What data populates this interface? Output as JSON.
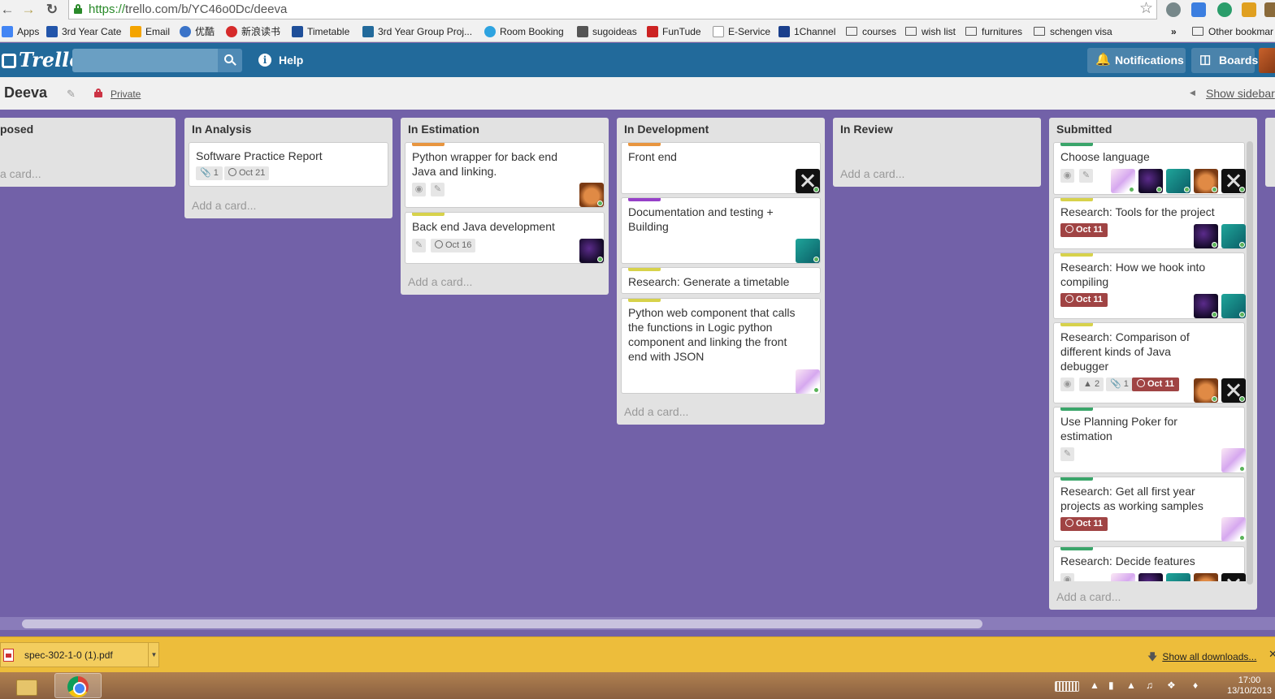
{
  "browser": {
    "url_scheme": "https://",
    "url_rest": "trello.com/b/YC46o0Dc/deeva",
    "bookmarks": [
      {
        "label": "Apps",
        "color": "#4285f4"
      },
      {
        "label": "3rd Year Cate",
        "color": "#2255aa"
      },
      {
        "label": "Email",
        "color": "#f4a400"
      },
      {
        "label": "优酷",
        "color": "#3a73c8"
      },
      {
        "label": "新浪读书",
        "color": "#d62b2b"
      },
      {
        "label": "Timetable",
        "color": "#1f4f99"
      },
      {
        "label": "3rd Year Group Proj...",
        "color": "#226a9b"
      },
      {
        "label": "Room Booking",
        "color": "#2ea3e0"
      },
      {
        "label": "sugoideas",
        "color": "#555555"
      },
      {
        "label": "FunTude",
        "color": "#cc2222"
      },
      {
        "label": "E-Service",
        "color": "#ffffff"
      },
      {
        "label": "1Channel",
        "color": "#1a3f8c"
      },
      {
        "label": "courses",
        "folder": true
      },
      {
        "label": "wish list",
        "folder": true
      },
      {
        "label": "furnitures",
        "folder": true
      },
      {
        "label": "schengen visa",
        "folder": true
      }
    ],
    "bookmarks_overflow": "»",
    "other_bookmarks": "Other bookmar"
  },
  "header": {
    "logo": "Trello",
    "search_placeholder": "",
    "help": "Help",
    "notifications": "Notifications",
    "boards": "Boards"
  },
  "board": {
    "title": "Deeva",
    "visibility": "Private",
    "show_sidebar": "Show sidebar"
  },
  "lists": [
    {
      "title": "posed",
      "add": "a card..."
    },
    {
      "title": "In Analysis",
      "add": "Add a card...",
      "cards": [
        {
          "title": "Software Practice Report",
          "attachments": "1",
          "due": "Oct 21"
        }
      ]
    },
    {
      "title": "In Estimation",
      "add": "Add a card...",
      "cards": [
        {
          "title": "Python wrapper for back end Java and linking.",
          "label_color": "#e8953f"
        },
        {
          "title": "Back end Java development",
          "label_color": "#d7d24b",
          "due": "Oct 16"
        }
      ]
    },
    {
      "title": "In Development",
      "add": "Add a card...",
      "cards": [
        {
          "title": "Front end",
          "label_color": "#e8953f"
        },
        {
          "title": "Documentation and testing + Building",
          "label_color": "#9640c8"
        },
        {
          "title": "Research: Generate a timetable",
          "label_color": "#d7d24b"
        },
        {
          "title": "Python web component that calls the functions in Logic python component and linking the front end with JSON",
          "label_color": "#d7d24b"
        }
      ]
    },
    {
      "title": "In Review",
      "add": "Add a card..."
    },
    {
      "title": "Submitted",
      "add": "Add a card...",
      "cards": [
        {
          "title": "Choose language",
          "label_color": "#3aa56a"
        },
        {
          "title": "Research: Tools for the project",
          "label_color": "#d7d24b",
          "due": "Oct 11"
        },
        {
          "title": "Research: How we hook into compiling",
          "label_color": "#d7d24b",
          "due": "Oct 11"
        },
        {
          "title": "Research: Comparison of different kinds of Java debugger",
          "label_color": "#d7d24b",
          "comments": "2",
          "attachments": "1",
          "due": "Oct 11"
        },
        {
          "title": "Use Planning Poker for estimation",
          "label_color": "#3aa56a"
        },
        {
          "title": "Research: Get all first year projects as working samples",
          "label_color": "#3aa56a",
          "due": "Oct 11"
        },
        {
          "title": "Research: Decide features",
          "label_color": "#3aa56a"
        }
      ]
    }
  ],
  "downloads": {
    "file": "spec-302-1-0 (1).pdf",
    "show_all": "Show all downloads..."
  },
  "taskbar": {
    "time": "17:00",
    "date": "13/10/2013"
  }
}
